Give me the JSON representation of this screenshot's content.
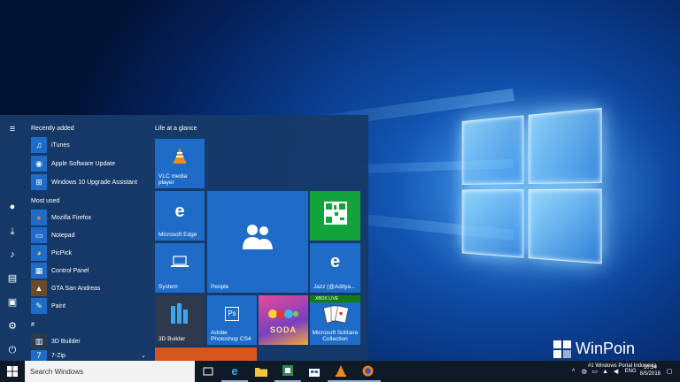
{
  "start_menu": {
    "recently_added_heading": "Recently added",
    "most_used_heading": "Most used",
    "hash_heading": "#",
    "recent_apps": [
      {
        "label": "iTunes",
        "icon": "music-note-icon"
      },
      {
        "label": "Apple Software Update",
        "icon": "apple-icon"
      },
      {
        "label": "Windows 10 Upgrade Assistant",
        "icon": "windows-icon"
      }
    ],
    "most_used_apps": [
      {
        "label": "Mozilla Firefox",
        "icon": "firefox-icon"
      },
      {
        "label": "Notepad",
        "icon": "notepad-icon"
      },
      {
        "label": "PicPick",
        "icon": "picpick-icon"
      },
      {
        "label": "Control Panel",
        "icon": "control-panel-icon"
      },
      {
        "label": "GTA San Andreas",
        "icon": "gta-icon"
      },
      {
        "label": "Paint",
        "icon": "paint-icon"
      }
    ],
    "hash_apps": [
      {
        "label": "3D Builder",
        "icon": "3d-builder-icon"
      },
      {
        "label": "7-Zip",
        "icon": "7zip-icon"
      }
    ],
    "tiles_heading": "Life at a glance",
    "tiles": {
      "vlc": "VLC media player",
      "edge": "Microsoft Edge",
      "people": "People",
      "system": "System",
      "jazz": "Jazz (@Aditya...",
      "builder3d": "3D Builder",
      "photoshop": "Adobe Photoshop CS4",
      "solitaire": "Microsoft Solitaire Collection",
      "xbox_live": "XBOX LIVE",
      "photoshop_badge": "Ps",
      "soda": "SODA"
    }
  },
  "taskbar": {
    "search_placeholder": "Search Windows",
    "tray_language": "ENG",
    "tray_time": "10:34",
    "tray_date": "8/5/2016",
    "watermark_tagline": "#1 Windows Portal Indonesia"
  },
  "watermark": {
    "brand": "WinPoin"
  },
  "colors": {
    "menu_bg": "#163a69",
    "tile_blue": "#1f6cc8",
    "tile_green": "#12a33a",
    "tile_orange": "#d7561d",
    "taskbar_bg": "#101a26"
  }
}
